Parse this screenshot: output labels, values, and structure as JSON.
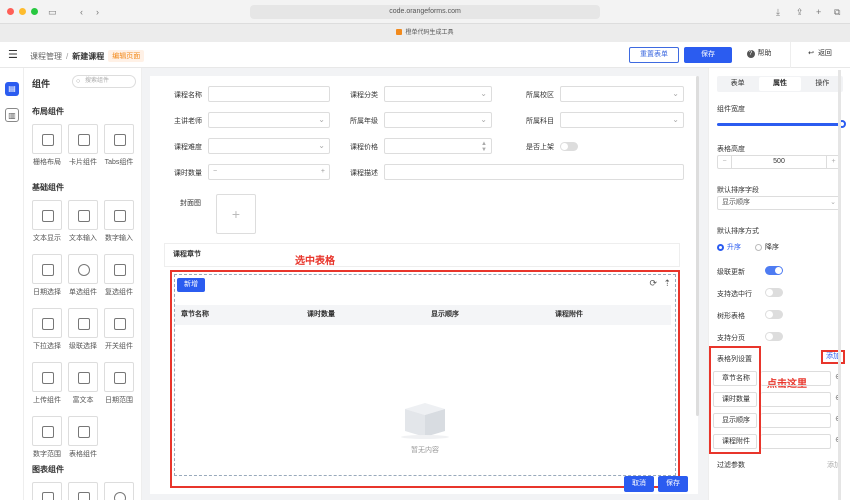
{
  "browser": {
    "url": "code.orangeforms.com",
    "tab_title": "橙单代码生成工具"
  },
  "header": {
    "breadcrumb_parent": "课程管理",
    "breadcrumb_sep": "/",
    "breadcrumb_current": "新建课程",
    "mode_tag": "编辑页面",
    "reset_button": "重置表单",
    "save_button": "保存",
    "help_button": "帮助",
    "back_button": "返回"
  },
  "palette": {
    "title": "组件",
    "search_placeholder": "搜索组件",
    "groups": [
      {
        "name": "布局组件",
        "items": [
          "栅格布局",
          "卡片组件",
          "Tabs组件"
        ]
      },
      {
        "name": "基础组件",
        "items": [
          "文本显示",
          "文本输入",
          "数字输入",
          "日期选择",
          "单选组件",
          "复选组件",
          "下拉选择",
          "级联选择",
          "开关组件",
          "上传组件",
          "富文本",
          "日期范围",
          "数字范围",
          "表格组件"
        ]
      },
      {
        "name": "图表组件",
        "items": []
      }
    ]
  },
  "form": {
    "fields": {
      "course_name": "课程名称",
      "course_category": "课程分类",
      "campus": "所属校区",
      "teacher": "主讲老师",
      "grade": "所属年级",
      "subject": "所属科目",
      "difficulty": "课程难度",
      "price": "课程价格",
      "on_shelf": "是否上架",
      "hours": "课时数量",
      "description": "课程描述",
      "cover": "封面图"
    },
    "section_title": "课程章节",
    "annotation_selected": "选中表格",
    "table": {
      "new_button": "新增",
      "columns": [
        "章节名称",
        "课时数量",
        "显示顺序",
        "课程附件"
      ],
      "empty_text": "暂无内容",
      "cancel_button": "取消",
      "save_button": "保存"
    }
  },
  "props": {
    "tabs": [
      "表单",
      "属性",
      "操作"
    ],
    "active_tab": "属性",
    "width_label": "组件宽度",
    "width_value_fraction": 1.0,
    "height_label": "表格高度",
    "height_value": "500",
    "sort_field_label": "默认排序字段",
    "sort_field_value": "显示顺序",
    "sort_order_label": "默认排序方式",
    "sort_asc": "升序",
    "sort_desc": "降序",
    "cascade_label": "级联更新",
    "select_row_label": "支持选中行",
    "tree_label": "树形表格",
    "paging_label": "支持分页",
    "columns_label": "表格列设置",
    "add_link": "添加",
    "click_here": "点击这里",
    "column_items": [
      "章节名称",
      "课时数量",
      "显示顺序",
      "课程附件"
    ],
    "filter_label": "过滤参数",
    "filter_add": "添加"
  },
  "colors": {
    "primary": "#2b5cf0",
    "annotation_red": "#e8352b",
    "tag_orange": "#f28a1c"
  }
}
